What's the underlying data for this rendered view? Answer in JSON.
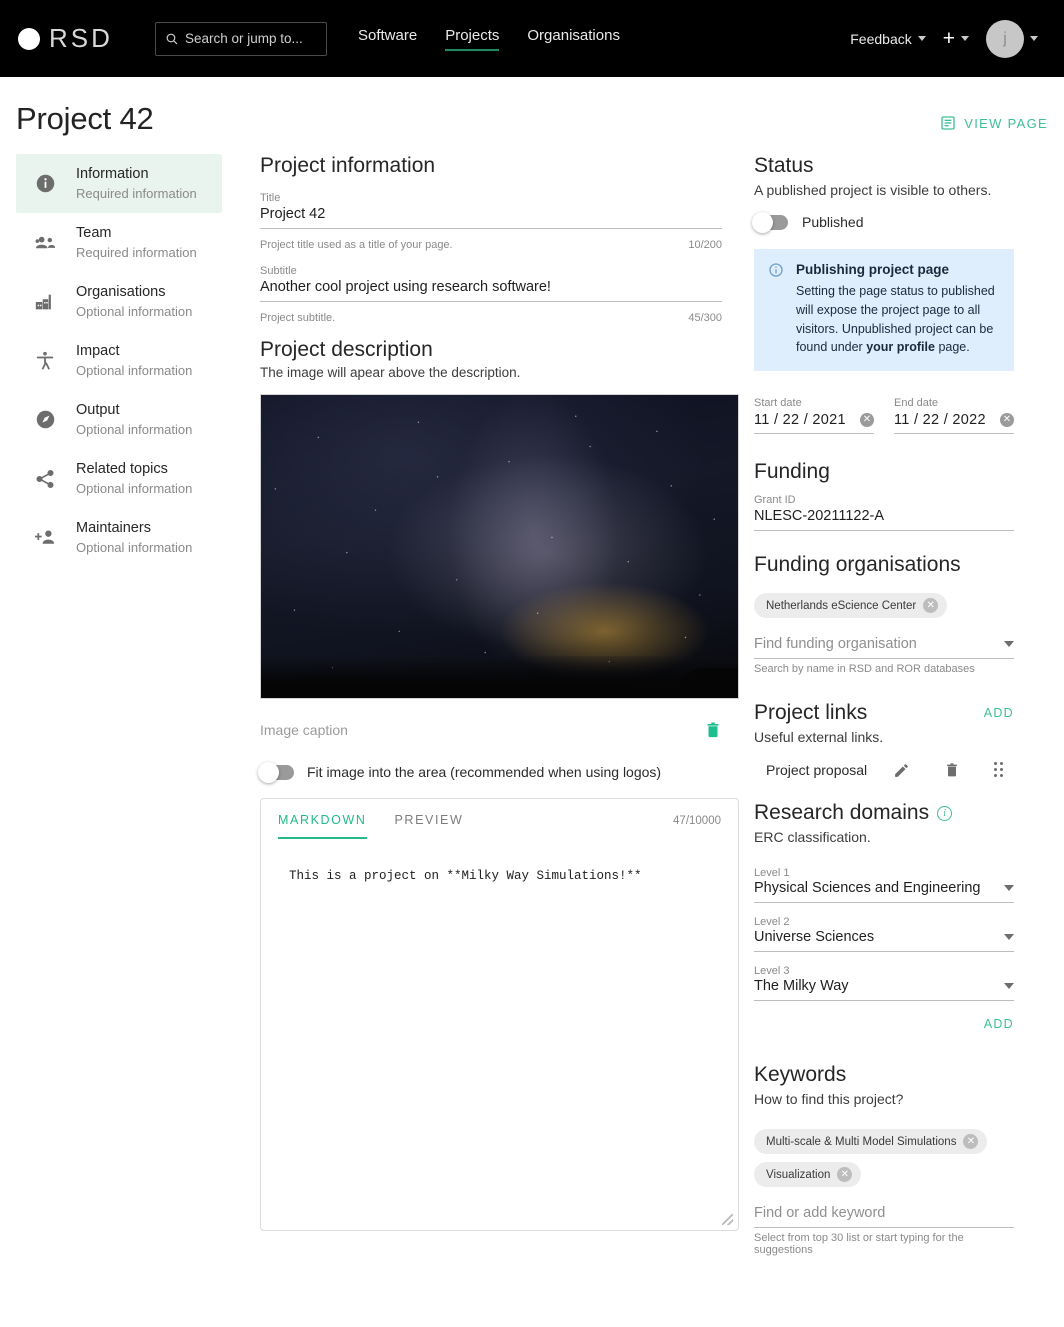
{
  "topbar": {
    "brand": "RSD",
    "search_placeholder": "Search or jump to...",
    "nav": [
      {
        "label": "Software",
        "active": false
      },
      {
        "label": "Projects",
        "active": true
      },
      {
        "label": "Organisations",
        "active": false
      }
    ],
    "feedback_label": "Feedback",
    "avatar_initial": "j"
  },
  "page": {
    "title": "Project 42",
    "view_page_label": "VIEW PAGE"
  },
  "sidebar": {
    "items": [
      {
        "icon": "info-icon",
        "label": "Information",
        "sub": "Required information",
        "active": true
      },
      {
        "icon": "team-icon",
        "label": "Team",
        "sub": "Required information",
        "active": false
      },
      {
        "icon": "organisation-icon",
        "label": "Organisations",
        "sub": "Optional information",
        "active": false
      },
      {
        "icon": "impact-icon",
        "label": "Impact",
        "sub": "Optional information",
        "active": false
      },
      {
        "icon": "output-icon",
        "label": "Output",
        "sub": "Optional information",
        "active": false
      },
      {
        "icon": "share-icon",
        "label": "Related topics",
        "sub": "Optional information",
        "active": false
      },
      {
        "icon": "person-add-icon",
        "label": "Maintainers",
        "sub": "Optional information",
        "active": false
      }
    ]
  },
  "project_information": {
    "heading": "Project information",
    "title_label": "Title",
    "title_value": "Project 42",
    "title_hint": "Project title used as a title of your page.",
    "title_counter": "10/200",
    "subtitle_label": "Subtitle",
    "subtitle_value": "Another cool project using research software!",
    "subtitle_hint": "Project subtitle.",
    "subtitle_counter": "45/300"
  },
  "project_description": {
    "heading": "Project description",
    "note": "The image will apear above the description.",
    "caption_placeholder": "Image caption",
    "fit_image_label": "Fit image into the area (recommended when using logos)",
    "fit_image_on": false,
    "tabs": [
      {
        "label": "MARKDOWN",
        "active": true
      },
      {
        "label": "PREVIEW",
        "active": false
      }
    ],
    "counter": "47/10000",
    "markdown_text": "This is a project on **Milky Way Simulations!**"
  },
  "status": {
    "heading": "Status",
    "note": "A published project is visible to others.",
    "toggle_label": "Published",
    "published": false,
    "info_title": "Publishing project page",
    "info_body_1": "Setting the page status to published will expose the project page to all visitors. Unpublished project can be found under ",
    "info_body_bold": "your profile",
    "info_body_2": " page."
  },
  "dates": {
    "start_label": "Start date",
    "start_value": "11 / 22 / 2021",
    "end_label": "End date",
    "end_value": "11 / 22 / 2022"
  },
  "funding": {
    "heading": "Funding",
    "grant_label": "Grant ID",
    "grant_value": "NLESC-20211122-A",
    "orgs_heading": "Funding organisations",
    "org_chips": [
      "Netherlands eScience Center"
    ],
    "find_placeholder": "Find funding organisation",
    "find_hint": "Search by name in RSD and ROR databases"
  },
  "project_links": {
    "heading": "Project links",
    "add_label": "ADD",
    "note": "Useful external links.",
    "rows": [
      {
        "name": "Project proposal"
      }
    ]
  },
  "research_domains": {
    "heading": "Research domains",
    "note": "ERC classification.",
    "levels": [
      {
        "label": "Level 1",
        "value": "Physical Sciences and Engineering"
      },
      {
        "label": "Level 2",
        "value": "Universe Sciences"
      },
      {
        "label": "Level 3",
        "value": "The Milky Way"
      }
    ],
    "add_label": "ADD"
  },
  "keywords": {
    "heading": "Keywords",
    "note": "How to find this project?",
    "chips": [
      "Multi-scale & Multi Model Simulations",
      "Visualization"
    ],
    "find_placeholder": "Find or add keyword",
    "hint": "Select from top 30 list or start typing for the suggestions"
  },
  "colors": {
    "accent": "#3dbf97",
    "accent_dark": "#23b98a",
    "nav_underline": "#1d8a65",
    "info_box_bg": "#dfeefc",
    "sidebar_active_bg": "#eaf4ef"
  }
}
